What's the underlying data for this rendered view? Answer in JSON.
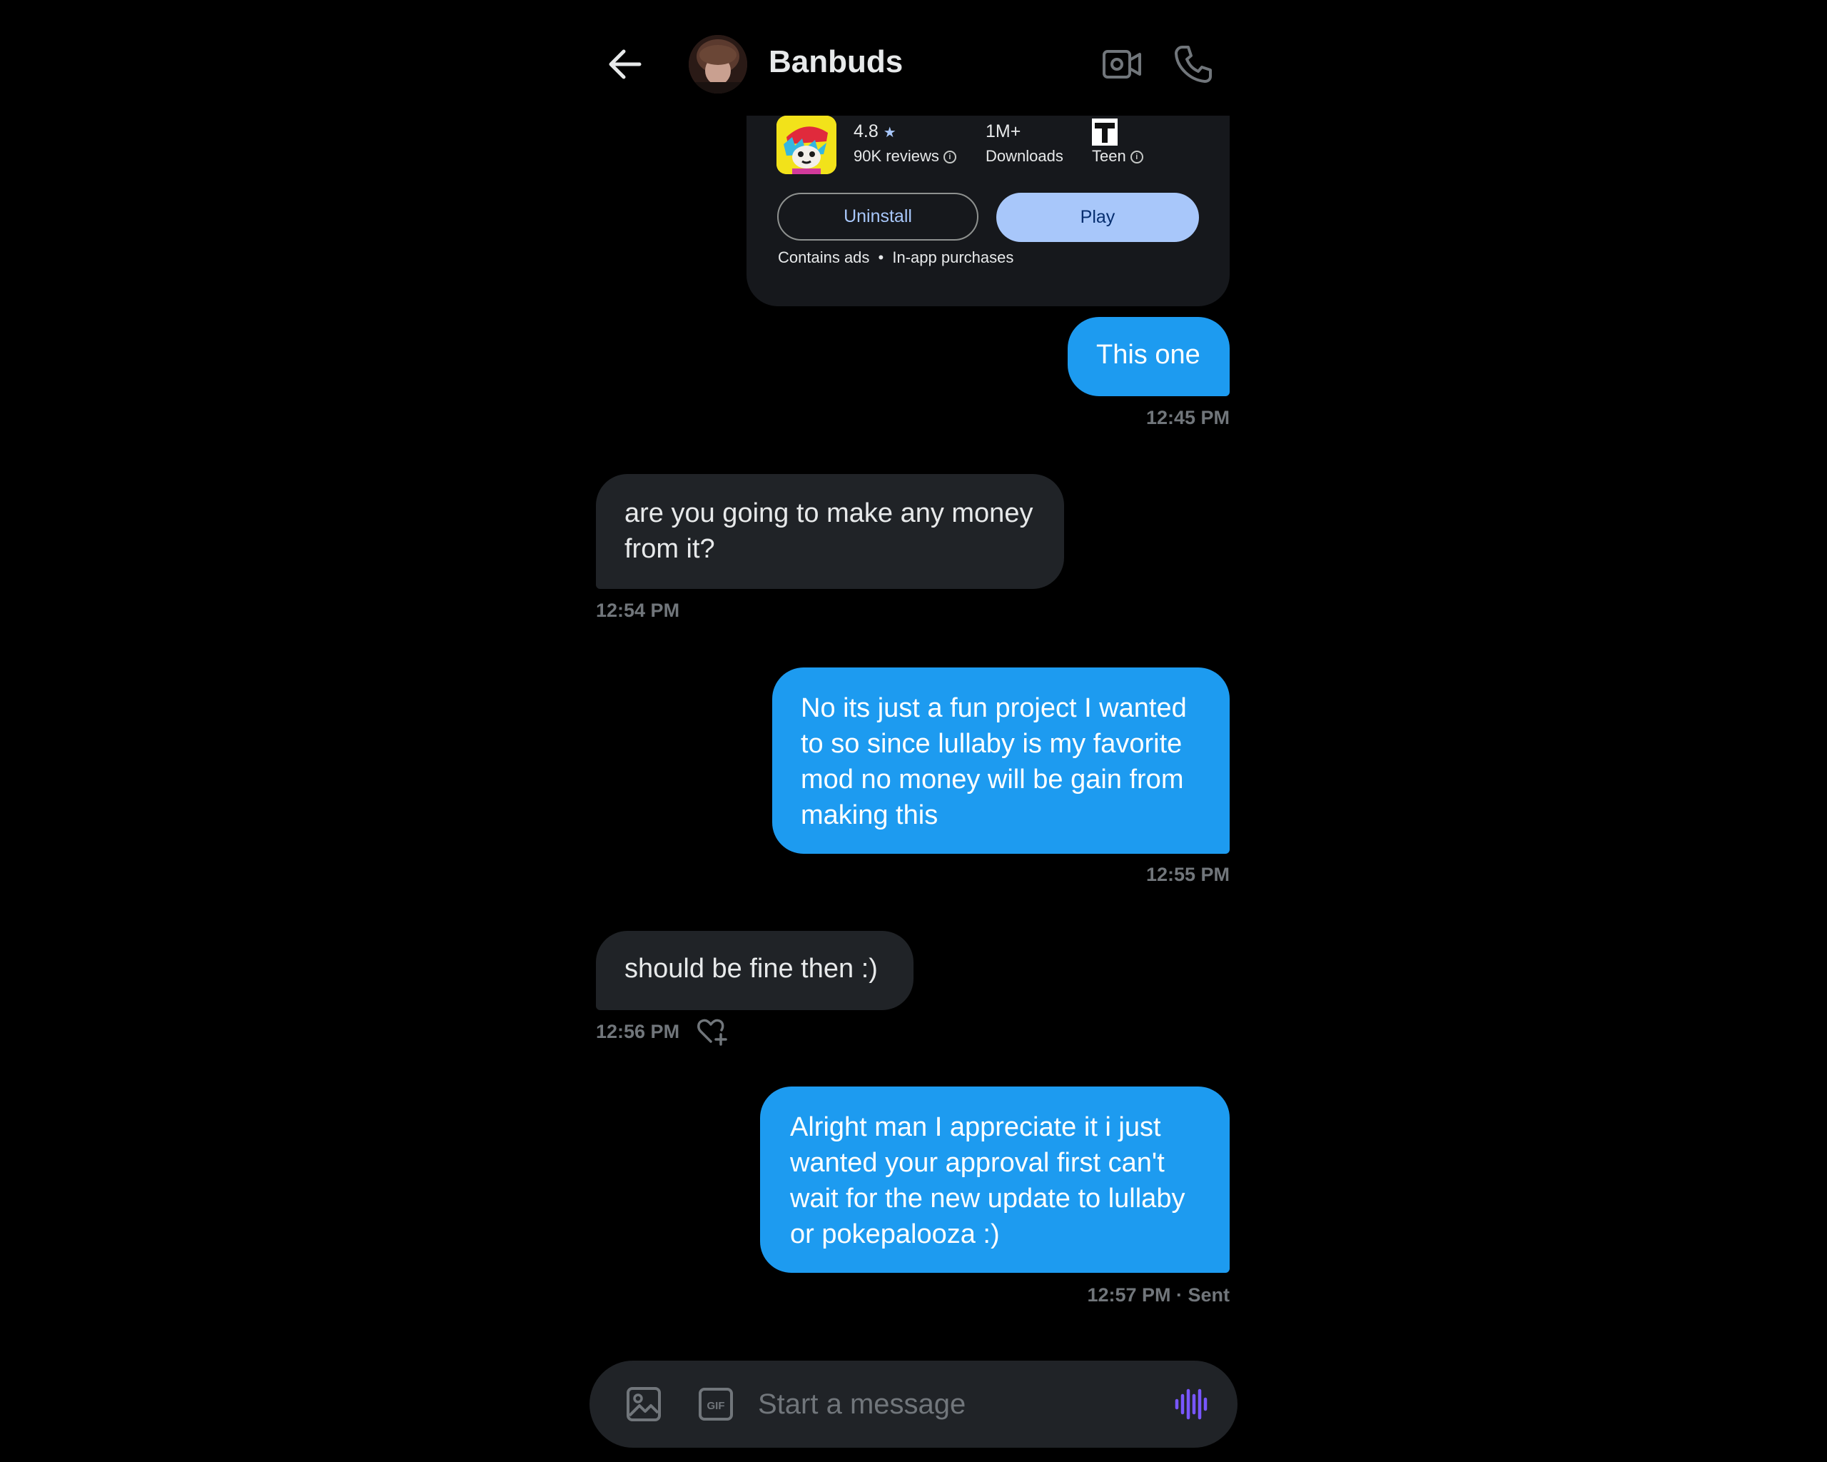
{
  "header": {
    "contact_name": "Banbuds"
  },
  "app_card": {
    "rating": "4.8",
    "reviews": "90K reviews",
    "downloads_value": "1M+",
    "downloads_label": "Downloads",
    "content_rating": "Teen",
    "uninstall_label": "Uninstall",
    "play_label": "Play",
    "footer_ads": "Contains ads",
    "footer_sep": "•",
    "footer_iap": "In-app purchases"
  },
  "messages": [
    {
      "direction": "outgoing",
      "text": "This one",
      "time": "12:45 PM"
    },
    {
      "direction": "incoming",
      "text": "are you going to make any money from it?",
      "time": "12:54 PM"
    },
    {
      "direction": "outgoing",
      "text": "No its just a fun project I wanted to so since lullaby is my favorite mod no money will be gain from making this",
      "time": "12:55 PM"
    },
    {
      "direction": "incoming",
      "text": "should be fine then :)",
      "time": "12:56 PM"
    },
    {
      "direction": "outgoing",
      "text": "Alright man I appreciate it i just wanted your approval first can't wait for the new update to lullaby or pokepalooza :)",
      "time": "12:57 PM · Sent"
    }
  ],
  "composer": {
    "placeholder": "Start a message",
    "gif_label": "GIF"
  },
  "colors": {
    "background": "#000000",
    "outgoing_bubble": "#1d9bf0",
    "incoming_bubble": "#202327",
    "timestamp": "#71767b",
    "play_button": "#a8c7fa",
    "voice_accent": "#7856ff"
  },
  "icons": {
    "back": "arrow-left-icon",
    "video": "video-camera-icon",
    "call": "phone-icon",
    "react": "heart-plus-icon",
    "media": "image-icon",
    "gif": "gif-icon",
    "voice": "waveform-icon"
  }
}
